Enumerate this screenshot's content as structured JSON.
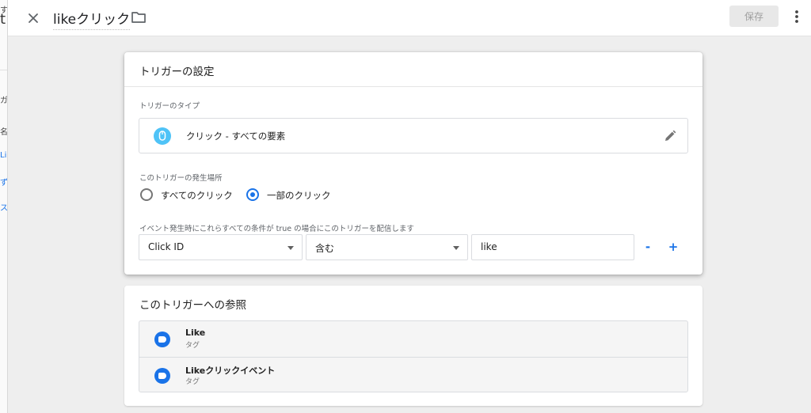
{
  "background_page": {
    "fragments": [
      "す",
      "t",
      "ガー",
      "名前",
      "Like",
      "ず",
      "ス"
    ]
  },
  "header": {
    "title": "likeクリック",
    "save_label": "保存",
    "close_icon": "close-icon",
    "folder_icon": "folder-icon",
    "more_icon": "more-vert-icon"
  },
  "trigger_card": {
    "title": "トリガーの設定",
    "type_section_label": "トリガーのタイプ",
    "type_label": "クリック - すべての要素",
    "type_icon": "mouse-icon",
    "edit_icon": "pencil-icon",
    "fire_on_label": "このトリガーの発生場所",
    "fire_on_options": [
      {
        "label": "すべてのクリック",
        "checked": false
      },
      {
        "label": "一部のクリック",
        "checked": true
      }
    ],
    "condition_label": "イベント発生時にこれらすべての条件が true の場合にこのトリガーを配信します",
    "condition": {
      "variable": "Click ID",
      "operator": "含む",
      "value": "like"
    },
    "remove_label": "-",
    "add_label": "+"
  },
  "references_card": {
    "title": "このトリガーへの参照",
    "items": [
      {
        "name": "Like",
        "type": "タグ"
      },
      {
        "name": "Likeクリックイベント",
        "type": "タグ"
      }
    ]
  },
  "colors": {
    "accent": "#1a73e8",
    "trigger_icon": "#4fc3f7",
    "tag_icon": "#1a73e8"
  }
}
